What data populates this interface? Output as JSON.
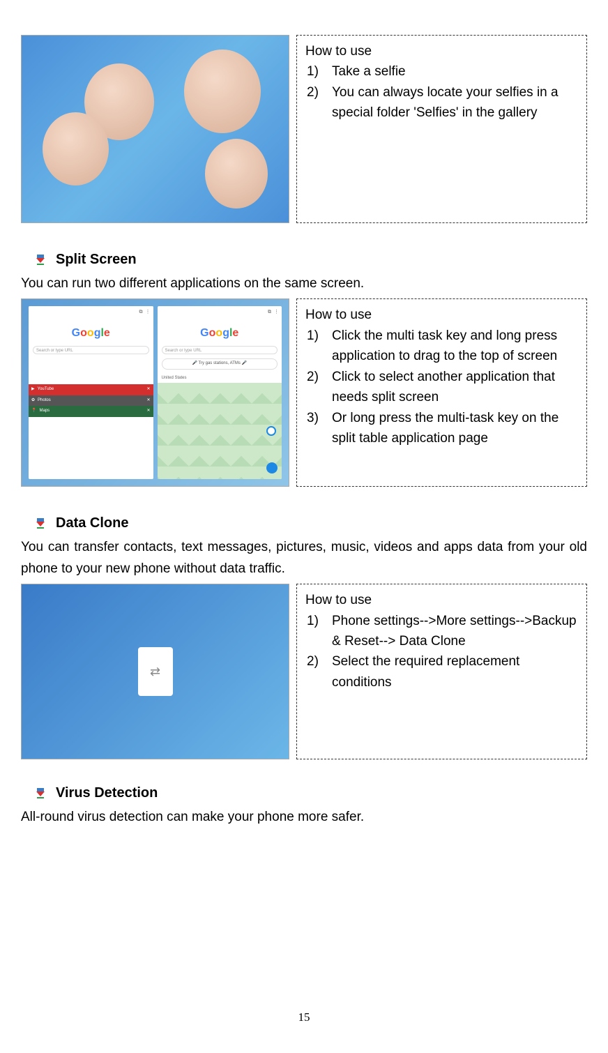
{
  "section1": {
    "howto_title": "How to use",
    "items": [
      {
        "num": "1)",
        "text": "Take a selfie"
      },
      {
        "num": "2)",
        "text": "You can always locate your selfies in a special folder 'Selfies' in the gallery"
      }
    ]
  },
  "section2": {
    "title": "Split Screen",
    "desc": "You can run two different applications on the same screen.",
    "howto_title": "How to use",
    "items": [
      {
        "num": "1)",
        "text": "Click the multi task key and long press application to drag to the top of screen"
      },
      {
        "num": "2)",
        "text": "Click to select another application that needs split screen"
      },
      {
        "num": "3)",
        "text": "Or long press the multi-task key on the split table application page"
      }
    ],
    "shot": {
      "search_label": "Search or type URL",
      "try_label": "Try gas stations, ATMs",
      "us_label": "United States",
      "yt": "YouTube",
      "ph": "Photos",
      "mp": "Maps"
    }
  },
  "section3": {
    "title": "Data Clone",
    "desc": "You can transfer contacts, text messages, pictures, music, videos and apps data from your old phone to your new phone without data traffic.",
    "howto_title": "How to use",
    "items": [
      {
        "num": "1)",
        "text": "Phone settings-->More settings-->Backup & Reset--> Data Clone"
      },
      {
        "num": "2)",
        "text": "Select the required replacement conditions"
      }
    ]
  },
  "section4": {
    "title": "Virus Detection",
    "desc": "All-round virus detection can make your phone more safer."
  },
  "page_number": "15"
}
